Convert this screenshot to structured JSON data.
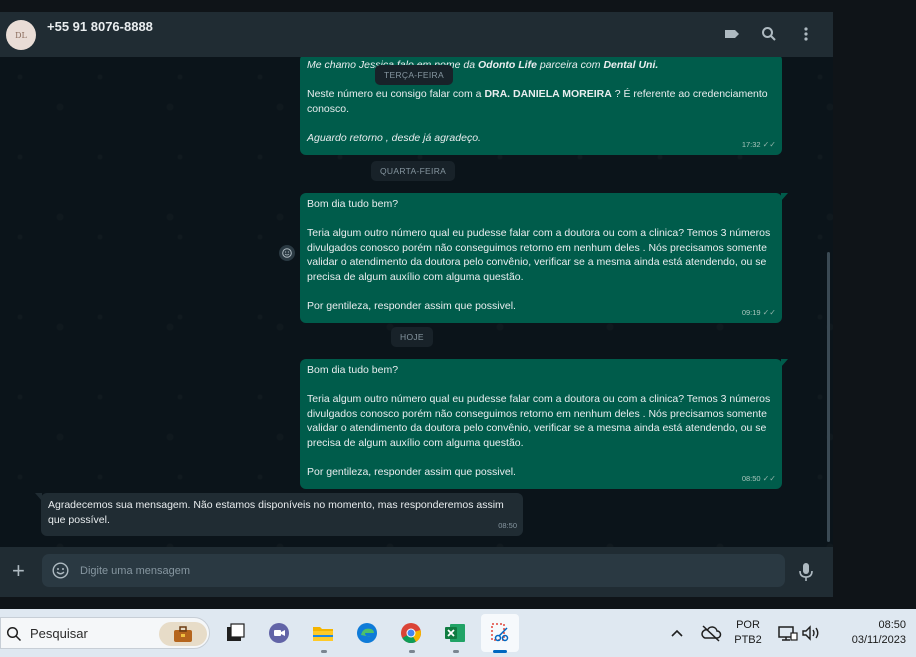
{
  "header": {
    "avatar_text": "DL",
    "contact_name": "+55 91 8076-8888",
    "icons": [
      "label-icon",
      "search-icon",
      "menu-icon"
    ]
  },
  "chat": {
    "messages": [
      {
        "lines": [
          "Me chamo Jessica falo em nome da Odonto Life parceira com Dental Uni.",
          "",
          "Neste número eu consigo falar com a DRA. DANIELA MOREIRA ? É referente ao credenciamento conosco.",
          "",
          "Aguardo retorno , desde já agradeço."
        ],
        "time": "17:32"
      },
      {
        "lines": [
          "Bom dia tudo bem?",
          "",
          "Teria algum outro número qual eu pudesse falar com a doutora ou com a clinica? Temos 3 números divulgados conosco porém não conseguimos retorno em nenhum deles . Nós precisamos somente validar o atendimento da doutora pelo convênio, verificar se a mesma ainda está atendendo, ou se precisa de algum auxílio com alguma questão.",
          "",
          "Por gentileza, responder assim que possivel."
        ],
        "time": "09:19"
      },
      {
        "lines": [
          "Bom dia tudo bem?",
          "",
          "Teria algum outro número qual eu pudesse falar com a doutora ou com a clinica? Temos 3 números divulgados conosco porém não conseguimos retorno em nenhum deles . Nós precisamos somente validar o atendimento da doutora pelo convênio, verificar se a mesma ainda está atendendo, ou se precisa de algum auxílio com alguma questão.",
          "",
          "Por gentileza, responder assim que possivel."
        ],
        "time": "08:50"
      }
    ],
    "day_labels": [
      "TERÇA-FEIRA",
      "QUARTA-FEIRA",
      "HOJE"
    ],
    "incoming": {
      "text": "Agradecemos sua mensagem. Não estamos disponíveis no momento, mas responderemos assim que possível.",
      "time": "08:50"
    },
    "tick": "✓✓"
  },
  "footer": {
    "placeholder": "Digite uma mensagem"
  },
  "taskbar": {
    "search_label": "Pesquisar",
    "language": "POR",
    "layout": "PTB2",
    "time": "08:50",
    "date": "03/11/2023",
    "apps": [
      "task-view-icon",
      "teams-icon",
      "file-explorer-icon",
      "edge-icon",
      "chrome-icon",
      "excel-icon",
      "snipping-tool-icon"
    ]
  }
}
